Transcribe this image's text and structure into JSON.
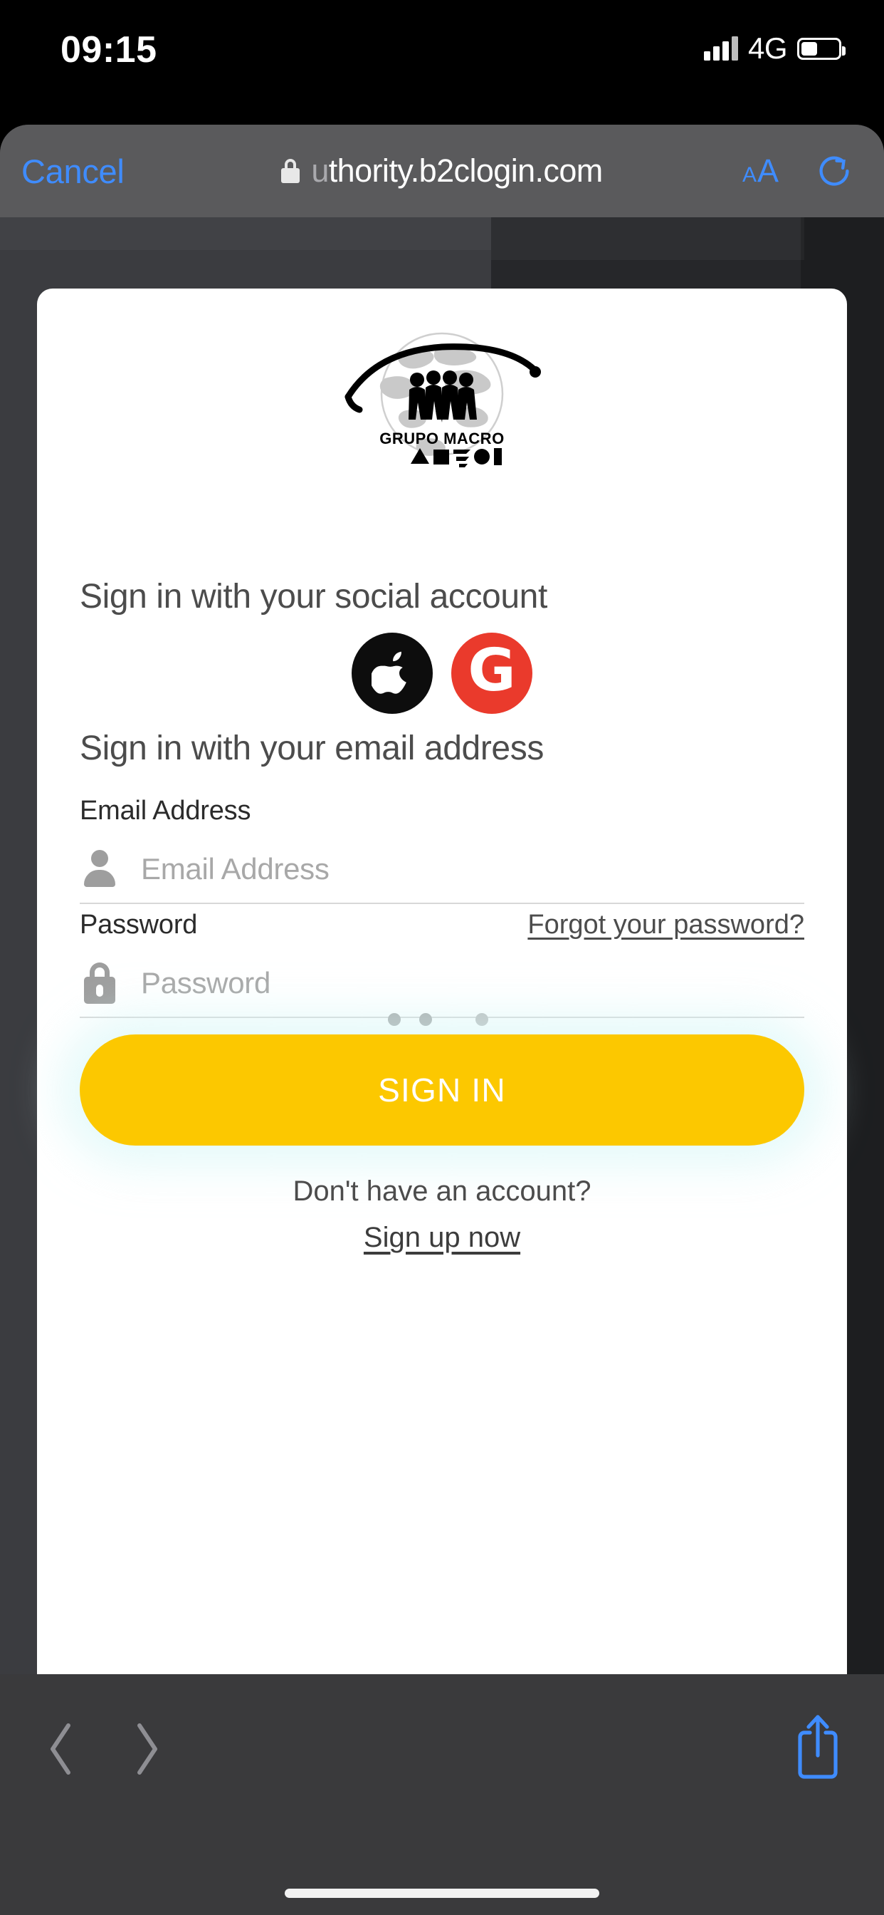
{
  "statusbar": {
    "time": "09:15",
    "network": "4G",
    "signal_icon": "cellular-bars-icon",
    "battery_icon": "battery-icon"
  },
  "browser": {
    "cancel_label": "Cancel",
    "lock_icon": "lock-icon",
    "url_dim_prefix": "u",
    "url": "thority.b2clogin.com",
    "text_size_small": "A",
    "text_size_large": "A",
    "reload_icon": "reload-icon",
    "back_icon": "chevron-left-icon",
    "forward_icon": "chevron-right-icon",
    "share_icon": "share-icon"
  },
  "page": {
    "logo": {
      "name": "grupo-macro-logo",
      "wordmark": "GRUPO MACRO"
    },
    "social_heading": "Sign in with your social account",
    "social_buttons": [
      {
        "name": "apple-signin-button",
        "icon": "apple-icon",
        "color": "#0d0d0d"
      },
      {
        "name": "google-signin-button",
        "icon": "google-icon",
        "letter": "G",
        "color": "#ea3a2c"
      }
    ],
    "email_heading": "Sign in with your email address",
    "email_label": "Email Address",
    "email_placeholder": "Email Address",
    "email_value": "",
    "email_icon": "person-icon",
    "password_label": "Password",
    "password_placeholder": "Password",
    "password_value": "",
    "password_icon": "lock-icon",
    "forgot_link": "Forgot your password?",
    "loading_indicator": "three-dots-loading",
    "signin_button": "SIGN IN",
    "signin_button_color": "#fcc800",
    "signup_question": "Don't have an account?",
    "signup_link": "Sign up now"
  }
}
